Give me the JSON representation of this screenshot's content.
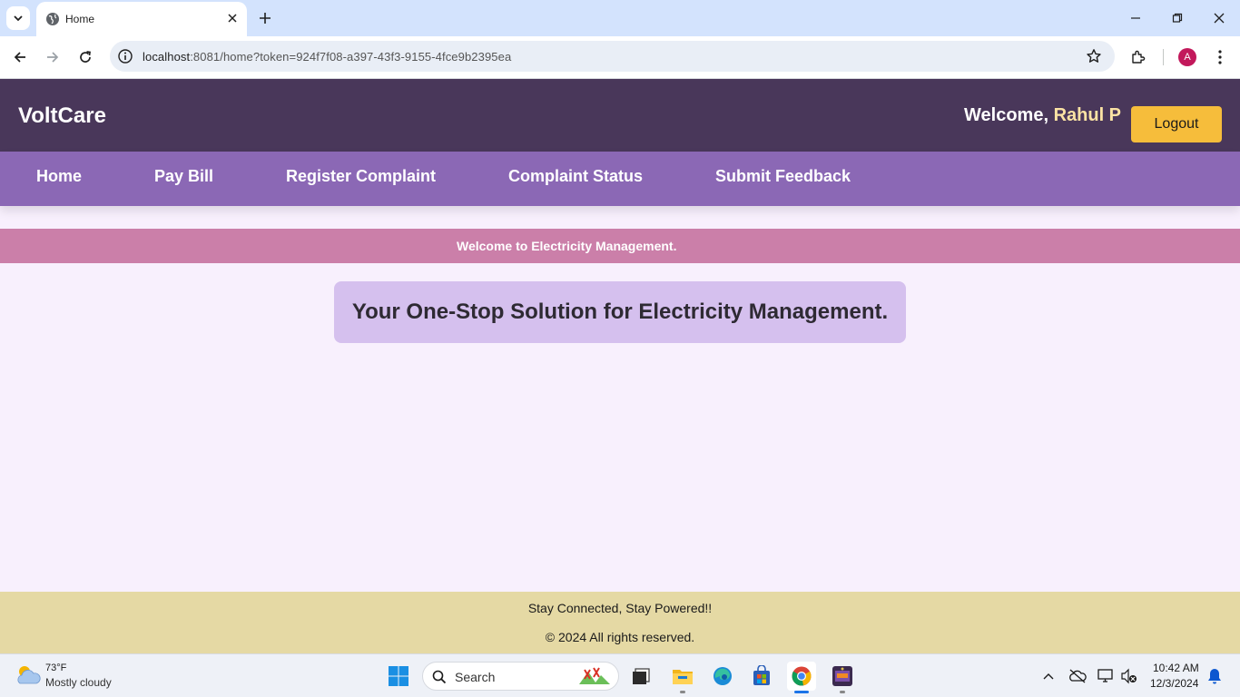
{
  "browser": {
    "tab_title": "Home",
    "url_host": "localhost",
    "url_rest": ":8081/home?token=924f7f08-a397-43f3-9155-4fce9b2395ea",
    "profile_initial": "A",
    "profile_color": "#c2185b"
  },
  "app": {
    "brand": "VoltCare",
    "welcome_prefix": "Welcome, ",
    "user_name": "Rahul P",
    "logout_label": "Logout",
    "nav": [
      {
        "label": "Home"
      },
      {
        "label": "Pay Bill"
      },
      {
        "label": "Register Complaint"
      },
      {
        "label": "Complaint Status"
      },
      {
        "label": "Submit Feedback"
      }
    ],
    "marquee": "Welcome to Electricity Management.",
    "hero": "Your One-Stop Solution for Electricity Management.",
    "footer_line1": "Stay Connected, Stay Powered!!",
    "footer_line2": "© 2024 All rights reserved.",
    "colors": {
      "header": "#49375a",
      "nav": "#8b68b5",
      "marquee": "#cb7fa9",
      "hero": "#d5c0ee",
      "footer": "#e5d9a4",
      "logout": "#f6bd3b",
      "page_bg": "#f8f0fd"
    }
  },
  "taskbar": {
    "weather_temp": "73°F",
    "weather_desc": "Mostly cloudy",
    "search_label": "Search",
    "time": "10:42 AM",
    "date": "12/3/2024",
    "apps": [
      "task-view-icon",
      "file-explorer-icon",
      "edge-icon",
      "store-icon",
      "chrome-icon",
      "game-app-icon"
    ]
  }
}
